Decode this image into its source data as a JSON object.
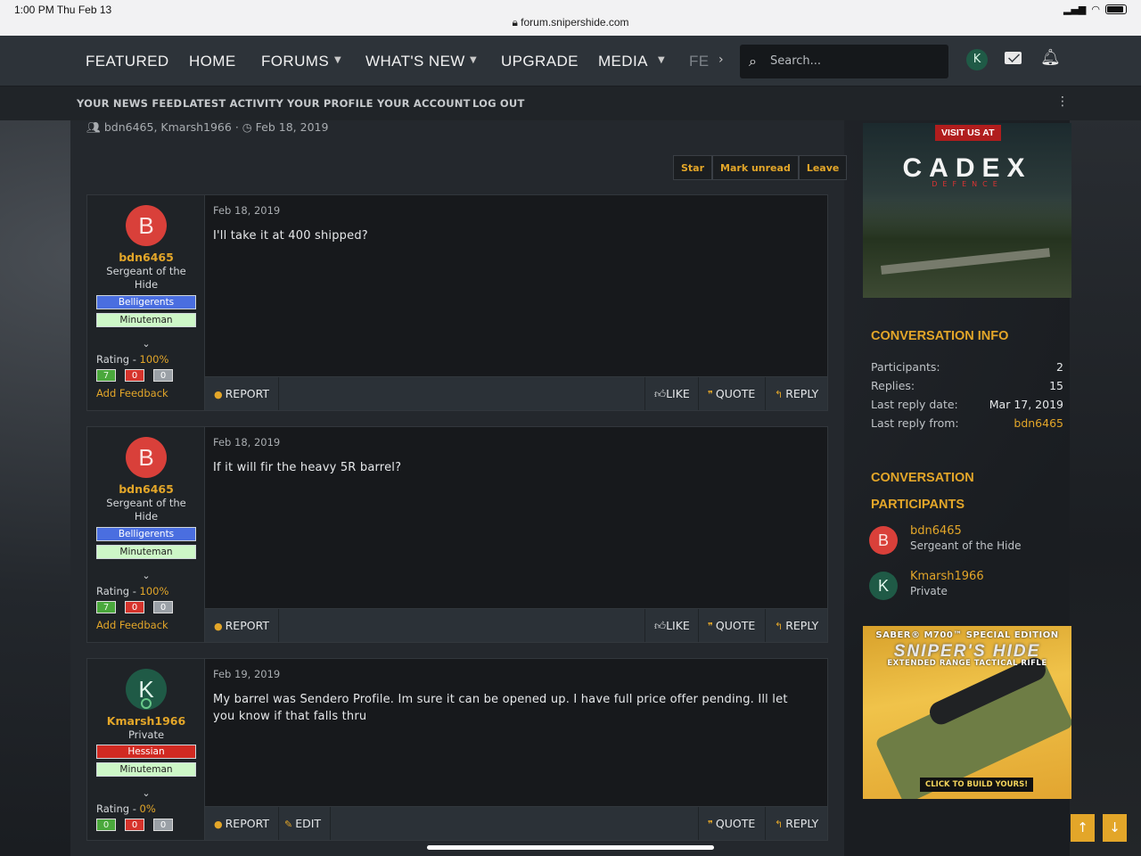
{
  "statusbar": {
    "time": "1:00 PM  Thu Feb 13",
    "url": "forum.snipershide.com"
  },
  "nav": {
    "items": [
      "FEATURED",
      "HOME",
      "FORUMS",
      "WHAT'S NEW",
      "UPGRADE",
      "MEDIA",
      "FE"
    ],
    "search_placeholder": "Search...",
    "avatar_letter": "K"
  },
  "subnav": [
    "YOUR NEWS FEED",
    "LATEST ACTIVITY",
    "YOUR PROFILE",
    "YOUR ACCOUNT",
    "LOG OUT"
  ],
  "conversation": {
    "participants_line": "bdn6465, Kmarsh1966",
    "date": "Feb 18, 2019",
    "actions": [
      "Star",
      "Mark unread",
      "Leave"
    ]
  },
  "messages": [
    {
      "avatar": "B",
      "username": "bdn6465",
      "title": "Sergeant of the Hide",
      "badges": [
        "Belligerents",
        "Minuteman"
      ],
      "rating_label": "Rating - ",
      "rating_pct": "100%",
      "votes": [
        "7",
        "0",
        "0"
      ],
      "feedback": "Add Feedback",
      "date": "Feb 18, 2019",
      "body": "I'll take it at 400 shipped?",
      "footer": {
        "report": "REPORT",
        "like": "LIKE",
        "quote": "QUOTE",
        "reply": "REPLY"
      }
    },
    {
      "avatar": "B",
      "username": "bdn6465",
      "title": "Sergeant of the Hide",
      "badges": [
        "Belligerents",
        "Minuteman"
      ],
      "rating_label": "Rating - ",
      "rating_pct": "100%",
      "votes": [
        "7",
        "0",
        "0"
      ],
      "feedback": "Add Feedback",
      "date": "Feb 18, 2019",
      "body": "If it will fir the heavy 5R barrel?",
      "footer": {
        "report": "REPORT",
        "like": "LIKE",
        "quote": "QUOTE",
        "reply": "REPLY"
      }
    },
    {
      "avatar": "K",
      "username": "Kmarsh1966",
      "title": "Private",
      "badges": [
        "Hessian",
        "Minuteman"
      ],
      "rating_label": "Rating - ",
      "rating_pct": "0%",
      "votes": [
        "0",
        "0",
        "0"
      ],
      "date": "Feb 19, 2019",
      "body": "My barrel was Sendero Profile. Im sure it can be opened up. I have full price offer pending. Ill let you know if that falls thru",
      "footer": {
        "report": "REPORT",
        "edit": "EDIT",
        "quote": "QUOTE",
        "reply": "REPLY"
      }
    }
  ],
  "sidebar": {
    "ad1": {
      "visit": "VISIT US AT",
      "logo": "CADEX",
      "sub": "DEFENCE"
    },
    "info": {
      "title": "CONVERSATION INFO",
      "rows": [
        {
          "label": "Participants:",
          "value": "2"
        },
        {
          "label": "Replies:",
          "value": "15"
        },
        {
          "label": "Last reply date:",
          "value": "Mar 17, 2019"
        },
        {
          "label": "Last reply from:",
          "value": "bdn6465"
        }
      ]
    },
    "participants": {
      "title_line1": "CONVERSATION",
      "title_line2": "PARTICIPANTS",
      "list": [
        {
          "avatar": "B",
          "name": "bdn6465",
          "title": "Sergeant of the Hide"
        },
        {
          "avatar": "K",
          "name": "Kmarsh1966",
          "title": "Private"
        }
      ]
    },
    "ad2": {
      "line1": "SABER® M700™ SPECIAL EDITION",
      "line2": "SNIPER'S HIDE",
      "line3": "EXTENDED RANGE TACTICAL RIFLE",
      "cta": "CLICK TO BUILD YOURS!"
    }
  },
  "colors": {
    "accent": "#e3a629",
    "nav_bg": "#2d3339",
    "post_bg": "#17191c"
  }
}
